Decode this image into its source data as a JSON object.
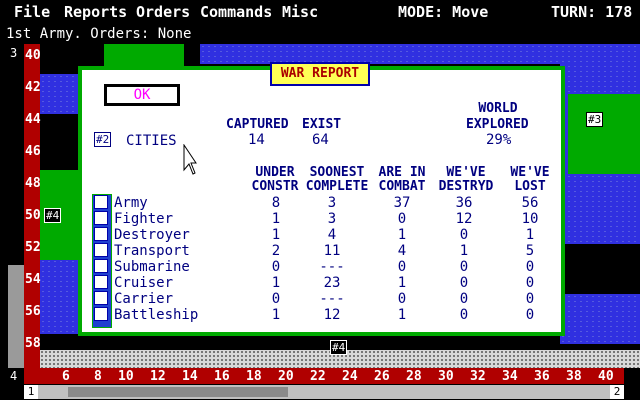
{
  "menu": {
    "items": [
      "File",
      "Reports",
      "Orders",
      "Commands",
      "Misc"
    ],
    "mode_label": "MODE: Move",
    "turn_label": "TURN: 178"
  },
  "status": {
    "text": "1st Army. Orders: None"
  },
  "rulers": {
    "left": [
      "40",
      "42",
      "44",
      "46",
      "48",
      "50",
      "52",
      "54",
      "56",
      "58"
    ],
    "bottom": [
      "6",
      "8",
      "10",
      "12",
      "14",
      "16",
      "18",
      "20",
      "22",
      "24",
      "26",
      "28",
      "30",
      "32",
      "34",
      "36",
      "38",
      "40"
    ],
    "corner_top": "3",
    "corner_bottom": "4",
    "scroll_left": "1",
    "scroll_right": "2"
  },
  "map_markers": {
    "cursor_city": "#4",
    "map_city": "#4",
    "right_city": "#3"
  },
  "colors": {
    "land": "#00aa00",
    "sea": "#3030e0",
    "ruler": "#b00000",
    "dialog_text": "#000080",
    "title_bg": "#ffff55"
  },
  "dialog": {
    "title": "WAR REPORT",
    "ok_label": "OK",
    "cities_icon": "#2",
    "cities_label": "CITIES",
    "captured_header": "CAPTURED",
    "exist_header": "EXIST",
    "explored_header_1": "WORLD",
    "explored_header_2": "EXPLORED",
    "captured_value": "14",
    "exist_value": "64",
    "explored_value": "29%",
    "columns": [
      [
        "UNDER",
        "CONSTR"
      ],
      [
        "SOONEST",
        "COMPLETE"
      ],
      [
        "ARE IN",
        "COMBAT"
      ],
      [
        "WE'VE",
        "DESTRYD"
      ],
      [
        "WE'VE",
        "LOST"
      ]
    ],
    "units": [
      {
        "name": "Army",
        "icon": "army-icon",
        "values": [
          "8",
          "3",
          "37",
          "36",
          "56"
        ]
      },
      {
        "name": "Fighter",
        "icon": "fighter-icon",
        "values": [
          "1",
          "3",
          "0",
          "12",
          "10"
        ]
      },
      {
        "name": "Destroyer",
        "icon": "destroyer-icon",
        "values": [
          "1",
          "4",
          "1",
          "0",
          "1"
        ]
      },
      {
        "name": "Transport",
        "icon": "transport-icon",
        "values": [
          "2",
          "11",
          "4",
          "1",
          "5"
        ]
      },
      {
        "name": "Submarine",
        "icon": "submarine-icon",
        "values": [
          "0",
          "---",
          "0",
          "0",
          "0"
        ]
      },
      {
        "name": "Cruiser",
        "icon": "cruiser-icon",
        "values": [
          "1",
          "23",
          "1",
          "0",
          "0"
        ]
      },
      {
        "name": "Carrier",
        "icon": "carrier-icon",
        "values": [
          "0",
          "---",
          "0",
          "0",
          "0"
        ]
      },
      {
        "name": "Battleship",
        "icon": "battleship-icon",
        "values": [
          "1",
          "12",
          "1",
          "0",
          "0"
        ]
      }
    ]
  }
}
